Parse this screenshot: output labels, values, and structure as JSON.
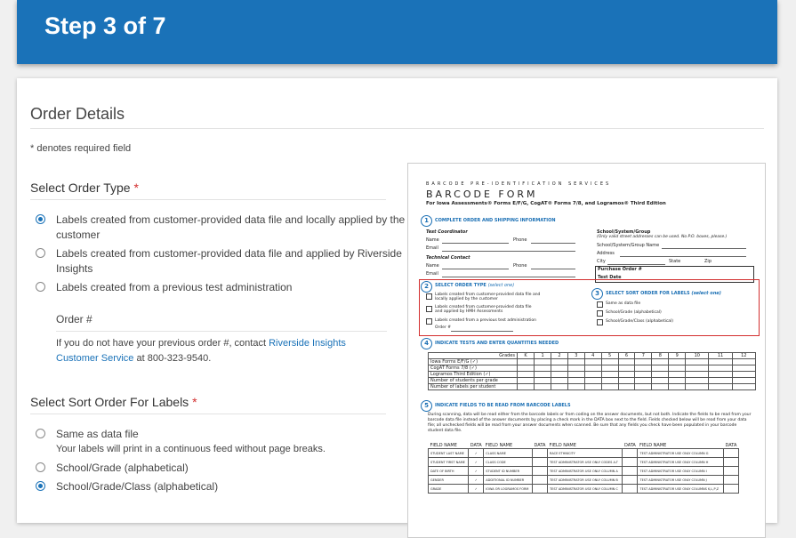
{
  "header": {
    "title": "Step 3 of 7"
  },
  "page": {
    "heading": "Order Details",
    "required_note": "* denotes required field"
  },
  "order_type": {
    "label": "Select Order Type",
    "required_mark": "*",
    "options": [
      {
        "label": "Labels created from customer-provided data file and locally applied by the customer",
        "selected": true
      },
      {
        "label": "Labels created from customer-provided data file and applied by Riverside Insights",
        "selected": false
      },
      {
        "label": "Labels created from a previous test administration",
        "selected": false
      }
    ],
    "order_number_label": "Order #",
    "help_prefix": "If you do not have your previous order #, contact",
    "help_link": "Riverside Insights Customer Service",
    "help_suffix": "at 800-323-9540."
  },
  "sort_order": {
    "label": "Select Sort Order For Labels",
    "required_mark": "*",
    "options": [
      {
        "label": "Same as data file",
        "selected": false
      },
      {
        "label": "School/Grade (alphabetical)",
        "selected": false
      },
      {
        "label": "School/Grade/Class (alphabetical)",
        "selected": true
      }
    ],
    "same_note": "Your labels will print in a continuous feed without page breaks."
  },
  "form_image": {
    "service_line": "BARCODE PRE-IDENTIFICATION SERVICES",
    "title": "BARCODE FORM",
    "subtitle": "For Iowa Assessments® Forms E/F/G, CogAT® Forms 7/8, and Logramos® Third Edition",
    "s1": "COMPLETE ORDER AND SHIPPING INFORMATION",
    "test_coordinator": "Test Coordinator",
    "technical_contact": "Technical Contact",
    "name": "Name",
    "phone": "Phone",
    "email": "Email",
    "school_group": "School/System/Group",
    "school_note": "(Only valid street addresses can be used. No P.O. boxes, please.)",
    "school_name": "School/System/Group Name",
    "address": "Address",
    "city": "City",
    "state": "State",
    "zip": "Zip",
    "purchase_order": "Purchase Order #",
    "test_date": "Test Date",
    "s2": "SELECT ORDER TYPE",
    "s2_note": "(select one)",
    "s2_opt1": "Labels created from customer-provided data file and locally applied by the customer",
    "s2_opt2": "Labels created from customer-provided data file and applied by HMH Assessments",
    "s2_opt3": "Labels created from a previous test administration",
    "s2_order": "Order #",
    "s3": "SELECT SORT ORDER FOR LABELS",
    "s3_note": "(select one)",
    "s3_opt1": "Same as data file",
    "s3_opt2": "School/Grade (alphabetical)",
    "s3_opt3": "School/Grade/Class (alphabetical)",
    "s4": "INDICATE TESTS AND ENTER QUANTITIES NEEDED",
    "grades_header": "Grades",
    "grades": [
      "K",
      "1",
      "2",
      "3",
      "4",
      "5",
      "6",
      "7",
      "8",
      "9",
      "10",
      "11",
      "12"
    ],
    "rows": [
      "Iowa Forms E/F/G (✓)",
      "CogAT Forms 7/8 (✓)",
      "Logramos Third Edition (✓)",
      "Number of students per grade",
      "Number of labels per student"
    ],
    "s5": "INDICATE FIELDS TO BE READ FROM BARCODE LABELS",
    "s5_text": "During scanning, data will be read either from the barcode labels or from coding on the answer documents, but not both. Indicate the fields to be read from your barcode data file instead of the answer documents by placing a check mark in the DATA box next to the field. Fields checked below will be read from your data file; all unchecked fields will be read from your answer documents when scanned. Be sure that any fields you check have been populated in your barcode student data file.",
    "field_name": "FIELD NAME",
    "data": "DATA",
    "fields": [
      [
        "STUDENT LAST NAME",
        "✓",
        "CLASS NAME",
        "",
        "RACE ETHNICITY",
        "",
        "TEST ADMINISTRATOR USE ONLY COLUMN G",
        ""
      ],
      [
        "STUDENT FIRST NAME",
        "✓",
        "CLASS CODE",
        "",
        "TEST ADMINISTRATOR USE ONLY CODES A-T",
        "",
        "TEST ADMINISTRATOR USE ONLY COLUMN H",
        ""
      ],
      [
        "DATE OF BIRTH",
        "✓",
        "STUDENT ID NUMBER",
        "",
        "TEST ADMINISTRATOR USE ONLY COLUMN A",
        "",
        "TEST ADMINISTRATOR USE ONLY COLUMN I",
        ""
      ],
      [
        "GENDER",
        "✓",
        "ADDITIONAL ID NUMBER",
        "",
        "TEST ADMINISTRATOR USE ONLY COLUMN B",
        "",
        "TEST ADMINISTRATOR USE ONLY COLUMN J",
        ""
      ],
      [
        "GRADE",
        "✓",
        "IOWA OR LOGRAMOS FORM",
        "",
        "TEST ADMINISTRATOR USE ONLY COLUMN C",
        "",
        "TEST ADMINISTRATOR USE ONLY COLUMNS K,L,P,Z",
        ""
      ]
    ]
  }
}
